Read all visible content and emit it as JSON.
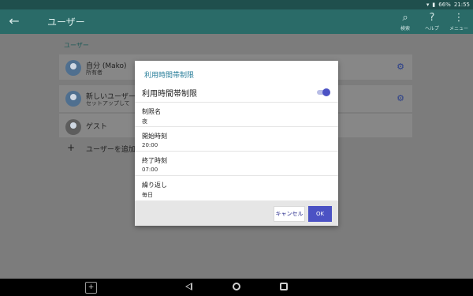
{
  "status": {
    "battery": "66%",
    "time": "21:55"
  },
  "appbar": {
    "title": "ユーザー",
    "actions": [
      {
        "icon": "search-icon",
        "label": "検索"
      },
      {
        "icon": "help-icon",
        "label": "ヘルプ"
      },
      {
        "icon": "more-vert-icon",
        "label": "メニュー"
      }
    ]
  },
  "users": {
    "section_title": "ユーザー",
    "items": [
      {
        "name": "自分 (Mako)",
        "subtitle": "所有者"
      },
      {
        "name": "新しいユーザー",
        "subtitle": "セットアップして"
      },
      {
        "name": "ゲスト"
      }
    ],
    "add_label": "ユーザーを追加"
  },
  "dialog": {
    "title": "利用時間帯制限",
    "toggle_label": "利用時間帯制限",
    "toggle_on": true,
    "fields": [
      {
        "label": "制限名",
        "value": "夜"
      },
      {
        "label": "開始時刻",
        "value": "20:00"
      },
      {
        "label": "終了時刻",
        "value": "07:00"
      },
      {
        "label": "繰り返し",
        "value": "毎日"
      }
    ],
    "cancel_label": "キャンセル",
    "ok_label": "OK"
  },
  "colors": {
    "accent": "#4b52c4",
    "appbar": "#2a6b68",
    "dialog_title": "#2b7f9b"
  }
}
